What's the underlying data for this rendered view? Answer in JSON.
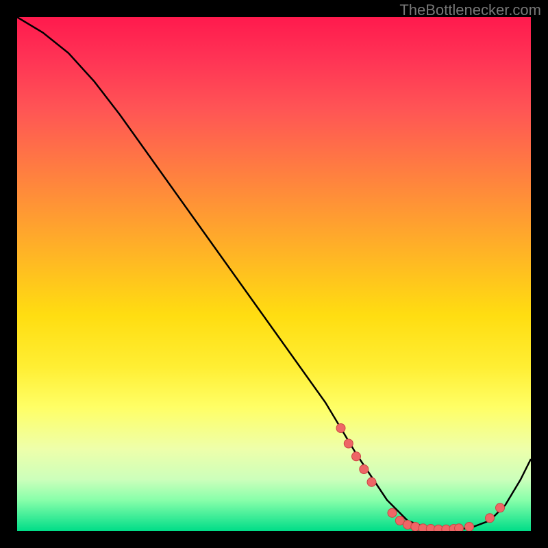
{
  "attribution": "TheBottlenecker.com",
  "chart_data": {
    "type": "line",
    "title": "",
    "xlabel": "",
    "ylabel": "",
    "xlim": [
      0,
      100
    ],
    "ylim": [
      0,
      100
    ],
    "series": [
      {
        "name": "curve",
        "x": [
          0,
          5,
          10,
          15,
          20,
          25,
          30,
          35,
          40,
          45,
          50,
          55,
          60,
          63,
          66,
          68,
          72,
          76,
          80,
          84,
          88,
          92,
          95,
          98,
          100
        ],
        "values": [
          100,
          97,
          93,
          87.5,
          81,
          74,
          67,
          60,
          53,
          46,
          39,
          32,
          25,
          20,
          15,
          12,
          6,
          2,
          0.5,
          0.3,
          0.5,
          2,
          5,
          10,
          14
        ]
      }
    ],
    "points": [
      {
        "x": 63.0,
        "y": 20.0
      },
      {
        "x": 64.5,
        "y": 17.0
      },
      {
        "x": 66.0,
        "y": 14.5
      },
      {
        "x": 67.5,
        "y": 12.0
      },
      {
        "x": 69.0,
        "y": 9.5
      },
      {
        "x": 73.0,
        "y": 3.5
      },
      {
        "x": 74.5,
        "y": 2.0
      },
      {
        "x": 76.0,
        "y": 1.2
      },
      {
        "x": 77.5,
        "y": 0.8
      },
      {
        "x": 79.0,
        "y": 0.5
      },
      {
        "x": 80.5,
        "y": 0.4
      },
      {
        "x": 82.0,
        "y": 0.3
      },
      {
        "x": 83.5,
        "y": 0.3
      },
      {
        "x": 85.0,
        "y": 0.4
      },
      {
        "x": 86.0,
        "y": 0.5
      },
      {
        "x": 88.0,
        "y": 0.8
      },
      {
        "x": 92.0,
        "y": 2.5
      },
      {
        "x": 94.0,
        "y": 4.5
      }
    ],
    "colors": {
      "curve": "#000000",
      "points_fill": "#ee6666",
      "gradient_top": "#ff1a4d",
      "gradient_mid": "#ffee00",
      "gradient_bottom": "#00dd88"
    }
  }
}
